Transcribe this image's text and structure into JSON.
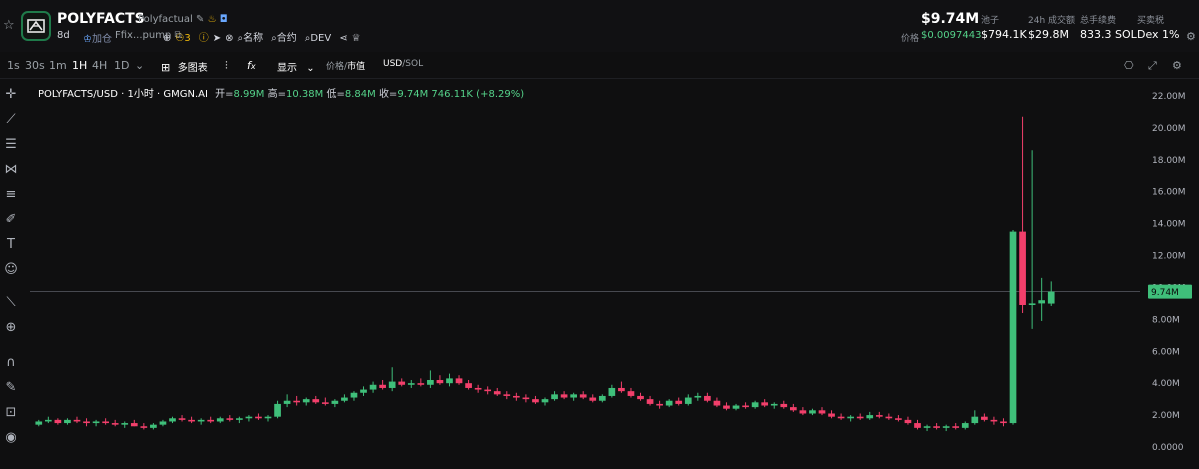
{
  "header": {
    "symbol": "POLYFACTS",
    "name": "Polyfactual",
    "age": "8d",
    "add_position": "加仓",
    "address": "Ffix...pump",
    "holders": "3",
    "links": [
      "名称",
      "合约",
      "DEV"
    ],
    "price_usd": "$9.74M",
    "price_label": "价格",
    "price_sol": "$0.0097443",
    "stats": [
      {
        "label": "池子",
        "value": "$794.1K"
      },
      {
        "label": "24h 成交额",
        "value": "$29.8M"
      },
      {
        "label": "总手续费",
        "value": "833.3 SOL"
      },
      {
        "label": "买卖税",
        "value": "Dex 1%"
      }
    ]
  },
  "toolbar": {
    "intervals": [
      "1s",
      "30s",
      "1m",
      "1H",
      "4H",
      "1D"
    ],
    "active_interval": "1H",
    "multi_chart": "多图表",
    "display": "显示",
    "price_label": "价格",
    "mcap_label": "市值",
    "usd_label": "USD",
    "sol_label": "SOL"
  },
  "legend": {
    "title": "POLYFACTS/USD · 1小时 · GMGN.AI",
    "open_label": "开=",
    "open": "8.99M",
    "high_label": "高=",
    "high": "10.38M",
    "low_label": "低=",
    "low": "8.84M",
    "close_label": "收=",
    "close": "9.74M",
    "volume": "746.11K",
    "change": "(+8.29%)"
  },
  "colors": {
    "up": "#3fbf7a",
    "down": "#f23f6b",
    "bg": "#0f0f10",
    "accent": "#55d38a"
  },
  "chart_data": {
    "type": "candlestick",
    "y_unit": "USD market cap (M)",
    "ylim": [
      0,
      22
    ],
    "y_ticks": [
      "22.00M",
      "20.00M",
      "18.00M",
      "16.00M",
      "14.00M",
      "12.00M",
      "10.00M",
      "8.00M",
      "6.00M",
      "4.00M",
      "2.00M",
      "0.0000"
    ],
    "last_price_label": "9.74M",
    "last_price": 9.74,
    "grid": false,
    "candles": [
      [
        1.4,
        1.7,
        1.3,
        1.6
      ],
      [
        1.6,
        1.9,
        1.5,
        1.7
      ],
      [
        1.7,
        1.8,
        1.4,
        1.5
      ],
      [
        1.5,
        1.8,
        1.4,
        1.7
      ],
      [
        1.7,
        1.9,
        1.5,
        1.6
      ],
      [
        1.6,
        1.8,
        1.3,
        1.5
      ],
      [
        1.5,
        1.7,
        1.3,
        1.6
      ],
      [
        1.6,
        1.8,
        1.4,
        1.5
      ],
      [
        1.5,
        1.7,
        1.3,
        1.4
      ],
      [
        1.4,
        1.6,
        1.2,
        1.5
      ],
      [
        1.5,
        1.7,
        1.3,
        1.3
      ],
      [
        1.3,
        1.5,
        1.1,
        1.2
      ],
      [
        1.2,
        1.5,
        1.1,
        1.4
      ],
      [
        1.4,
        1.7,
        1.3,
        1.6
      ],
      [
        1.6,
        1.9,
        1.5,
        1.8
      ],
      [
        1.8,
        2.0,
        1.6,
        1.7
      ],
      [
        1.7,
        1.9,
        1.5,
        1.6
      ],
      [
        1.6,
        1.8,
        1.4,
        1.7
      ],
      [
        1.7,
        1.9,
        1.5,
        1.6
      ],
      [
        1.6,
        1.9,
        1.5,
        1.8
      ],
      [
        1.8,
        2.0,
        1.6,
        1.7
      ],
      [
        1.7,
        1.9,
        1.5,
        1.8
      ],
      [
        1.8,
        2.0,
        1.6,
        1.9
      ],
      [
        1.9,
        2.1,
        1.7,
        1.8
      ],
      [
        1.8,
        2.0,
        1.6,
        1.9
      ],
      [
        1.9,
        2.9,
        1.8,
        2.7
      ],
      [
        2.7,
        3.3,
        2.5,
        2.9
      ],
      [
        2.9,
        3.2,
        2.6,
        2.8
      ],
      [
        2.8,
        3.1,
        2.6,
        3.0
      ],
      [
        3.0,
        3.2,
        2.7,
        2.8
      ],
      [
        2.8,
        3.1,
        2.6,
        2.7
      ],
      [
        2.7,
        3.0,
        2.5,
        2.9
      ],
      [
        2.9,
        3.3,
        2.8,
        3.1
      ],
      [
        3.1,
        3.5,
        2.9,
        3.4
      ],
      [
        3.4,
        3.8,
        3.2,
        3.6
      ],
      [
        3.6,
        4.1,
        3.4,
        3.9
      ],
      [
        3.9,
        4.2,
        3.6,
        3.7
      ],
      [
        3.7,
        5.0,
        3.5,
        4.1
      ],
      [
        4.1,
        4.3,
        3.8,
        3.9
      ],
      [
        3.9,
        4.2,
        3.7,
        4.0
      ],
      [
        4.0,
        4.3,
        3.8,
        3.9
      ],
      [
        3.9,
        4.8,
        3.7,
        4.2
      ],
      [
        4.2,
        4.5,
        3.9,
        4.0
      ],
      [
        4.0,
        4.6,
        3.8,
        4.3
      ],
      [
        4.3,
        4.5,
        3.9,
        4.0
      ],
      [
        4.0,
        4.2,
        3.6,
        3.7
      ],
      [
        3.7,
        3.9,
        3.4,
        3.6
      ],
      [
        3.6,
        3.8,
        3.3,
        3.5
      ],
      [
        3.5,
        3.7,
        3.2,
        3.3
      ],
      [
        3.3,
        3.5,
        3.0,
        3.2
      ],
      [
        3.2,
        3.4,
        2.9,
        3.1
      ],
      [
        3.1,
        3.3,
        2.8,
        3.0
      ],
      [
        3.0,
        3.2,
        2.7,
        2.8
      ],
      [
        2.8,
        3.1,
        2.6,
        3.0
      ],
      [
        3.0,
        3.5,
        2.9,
        3.3
      ],
      [
        3.3,
        3.5,
        3.0,
        3.1
      ],
      [
        3.1,
        3.4,
        2.9,
        3.3
      ],
      [
        3.3,
        3.5,
        3.0,
        3.1
      ],
      [
        3.1,
        3.3,
        2.8,
        2.9
      ],
      [
        2.9,
        3.3,
        2.8,
        3.2
      ],
      [
        3.2,
        3.9,
        3.1,
        3.7
      ],
      [
        3.7,
        4.1,
        3.4,
        3.5
      ],
      [
        3.5,
        3.7,
        3.1,
        3.2
      ],
      [
        3.2,
        3.4,
        2.9,
        3.0
      ],
      [
        3.0,
        3.2,
        2.6,
        2.7
      ],
      [
        2.7,
        2.9,
        2.4,
        2.6
      ],
      [
        2.6,
        3.0,
        2.5,
        2.9
      ],
      [
        2.9,
        3.1,
        2.6,
        2.7
      ],
      [
        2.7,
        3.3,
        2.6,
        3.1
      ],
      [
        3.1,
        3.4,
        2.9,
        3.2
      ],
      [
        3.2,
        3.4,
        2.8,
        2.9
      ],
      [
        2.9,
        3.1,
        2.5,
        2.6
      ],
      [
        2.6,
        2.8,
        2.3,
        2.4
      ],
      [
        2.4,
        2.7,
        2.3,
        2.6
      ],
      [
        2.6,
        2.8,
        2.4,
        2.5
      ],
      [
        2.5,
        2.9,
        2.4,
        2.8
      ],
      [
        2.8,
        3.0,
        2.5,
        2.6
      ],
      [
        2.6,
        2.8,
        2.4,
        2.7
      ],
      [
        2.7,
        2.9,
        2.4,
        2.5
      ],
      [
        2.5,
        2.7,
        2.2,
        2.3
      ],
      [
        2.3,
        2.5,
        2.0,
        2.1
      ],
      [
        2.1,
        2.4,
        2.0,
        2.3
      ],
      [
        2.3,
        2.5,
        2.0,
        2.1
      ],
      [
        2.1,
        2.3,
        1.8,
        1.9
      ],
      [
        1.9,
        2.1,
        1.7,
        1.8
      ],
      [
        1.8,
        2.0,
        1.6,
        1.9
      ],
      [
        1.9,
        2.1,
        1.7,
        1.8
      ],
      [
        1.8,
        2.2,
        1.7,
        2.0
      ],
      [
        2.0,
        2.2,
        1.8,
        1.9
      ],
      [
        1.9,
        2.1,
        1.7,
        1.8
      ],
      [
        1.8,
        2.0,
        1.6,
        1.7
      ],
      [
        1.7,
        1.9,
        1.4,
        1.5
      ],
      [
        1.5,
        1.7,
        1.1,
        1.2
      ],
      [
        1.2,
        1.4,
        1.0,
        1.3
      ],
      [
        1.3,
        1.5,
        1.1,
        1.2
      ],
      [
        1.2,
        1.4,
        1.0,
        1.3
      ],
      [
        1.3,
        1.5,
        1.1,
        1.2
      ],
      [
        1.2,
        1.6,
        1.1,
        1.5
      ],
      [
        1.5,
        2.3,
        1.4,
        1.9
      ],
      [
        1.9,
        2.1,
        1.6,
        1.7
      ],
      [
        1.7,
        1.9,
        1.4,
        1.6
      ],
      [
        1.6,
        1.8,
        1.3,
        1.5
      ],
      [
        1.5,
        13.6,
        1.4,
        13.5
      ],
      [
        13.5,
        20.7,
        8.4,
        8.9
      ],
      [
        8.9,
        18.6,
        7.4,
        9.0
      ],
      [
        9.0,
        10.6,
        7.9,
        9.2
      ],
      [
        8.99,
        10.38,
        8.84,
        9.74
      ]
    ]
  }
}
